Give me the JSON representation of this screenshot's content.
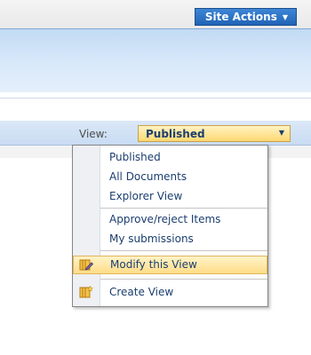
{
  "toolbar": {
    "site_actions_label": "Site Actions",
    "site_actions_caret": "▼"
  },
  "view": {
    "label": "View:",
    "selected": "Published",
    "arrow": "▼"
  },
  "menu": {
    "items": [
      {
        "label": "Published",
        "icon": null
      },
      {
        "label": "All Documents",
        "icon": null
      },
      {
        "label": "Explorer View",
        "icon": null
      },
      {
        "label": "Approve/reject Items",
        "icon": null
      },
      {
        "label": "My submissions",
        "icon": null
      },
      {
        "label": "Modify this View",
        "icon": "modify-view-icon",
        "highlighted": true
      },
      {
        "label": "Create View",
        "icon": "create-view-icon"
      }
    ]
  }
}
